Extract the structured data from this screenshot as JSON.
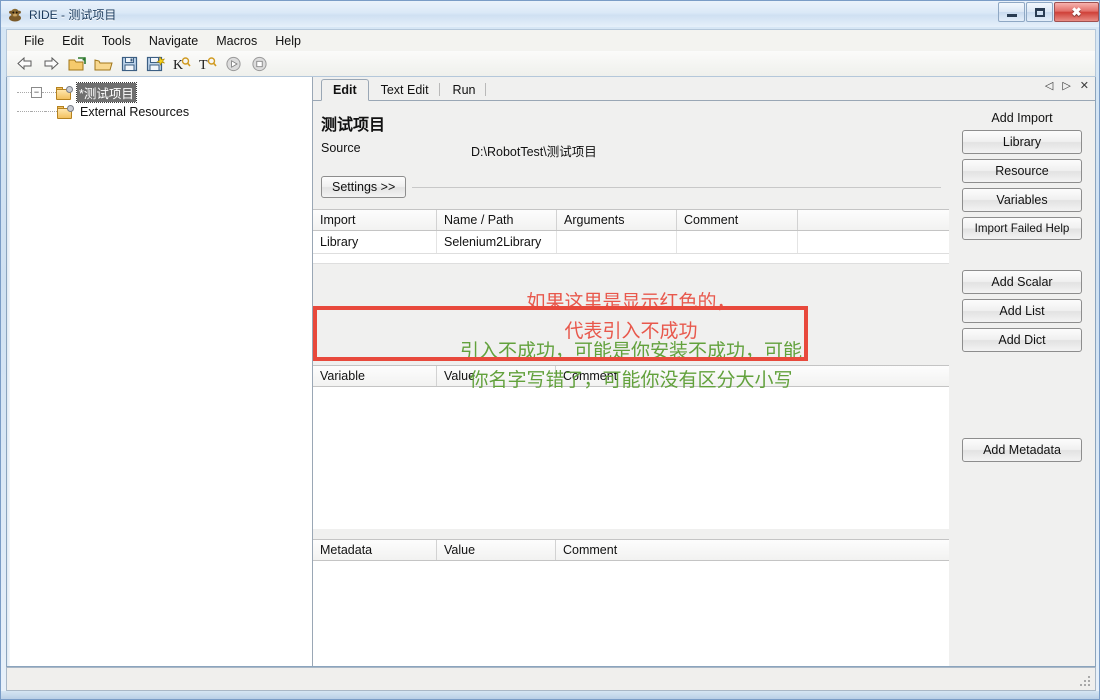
{
  "window": {
    "title": "RIDE - 测试项目",
    "app_icon": "robot-icon",
    "minimize_label": "Minimize",
    "maximize_label": "Maximize",
    "close_label": "✖"
  },
  "menubar": {
    "items": [
      {
        "label": "File",
        "name": "menu-file"
      },
      {
        "label": "Edit",
        "name": "menu-edit"
      },
      {
        "label": "Tools",
        "name": "menu-tools"
      },
      {
        "label": "Navigate",
        "name": "menu-navigate"
      },
      {
        "label": "Macros",
        "name": "menu-macros"
      },
      {
        "label": "Help",
        "name": "menu-help"
      }
    ]
  },
  "toolbar": {
    "buttons": [
      {
        "icon": "back-arrow-icon",
        "glyph": "⇦"
      },
      {
        "icon": "forward-arrow-icon",
        "glyph": "⇨"
      },
      {
        "icon": "open-directory-icon",
        "glyph": "📂"
      },
      {
        "icon": "open-file-icon",
        "glyph": "📁"
      },
      {
        "icon": "save-icon",
        "glyph": "💾"
      },
      {
        "icon": "save-all-icon",
        "glyph": "💾"
      },
      {
        "icon": "search-keyword-icon",
        "glyph": "K"
      },
      {
        "icon": "search-tests-icon",
        "glyph": "T"
      },
      {
        "icon": "run-icon",
        "glyph": "▶"
      },
      {
        "icon": "stop-icon",
        "glyph": "■"
      }
    ]
  },
  "tree": {
    "nodes": [
      {
        "label": "*测试项目",
        "name": "tree-node-project",
        "selected": true
      },
      {
        "label": "External Resources",
        "name": "tree-node-external-resources",
        "selected": false
      }
    ],
    "collapse_glyph": "−"
  },
  "tabs": {
    "items": [
      {
        "label": "Edit",
        "name": "tab-edit",
        "active": true
      },
      {
        "label": "Text Edit",
        "name": "tab-text-edit",
        "active": false
      },
      {
        "label": "Run",
        "name": "tab-run",
        "active": false
      }
    ],
    "nav_prev": "◁",
    "nav_next": "▷",
    "nav_close": "✕"
  },
  "project": {
    "title": "测试项目",
    "source_label": "Source",
    "source_value": "D:\\RobotTest\\测试项目",
    "settings_button": "Settings >>"
  },
  "import_grid": {
    "headers": [
      "Import",
      "Name / Path",
      "Arguments",
      "Comment"
    ],
    "rows": [
      [
        "Library",
        "Selenium2Library",
        "",
        ""
      ]
    ]
  },
  "variable_grid": {
    "headers": [
      "Variable",
      "Value",
      "Comment"
    ],
    "rows": []
  },
  "metadata_grid": {
    "headers": [
      "Metadata",
      "Value",
      "Comment"
    ],
    "rows": []
  },
  "annotations": {
    "red_text": "如果这里是显示红色的，\n代表引入不成功",
    "red_color": "#e8584c",
    "green_text": "引入不成功，可能是你安装不成功，可能\n你名字写错了，可能你没有区分大小写",
    "green_color": "#62a13c",
    "highlight_box_color": "#e8493c"
  },
  "sidebar": {
    "add_import_title": "Add Import",
    "import_buttons": [
      {
        "label": "Library",
        "name": "add-library-button"
      },
      {
        "label": "Resource",
        "name": "add-resource-button"
      },
      {
        "label": "Variables",
        "name": "add-variables-button"
      },
      {
        "label": "Import Failed Help",
        "name": "import-failed-help-button"
      }
    ],
    "variable_buttons": [
      {
        "label": "Add Scalar",
        "name": "add-scalar-button"
      },
      {
        "label": "Add List",
        "name": "add-list-button"
      },
      {
        "label": "Add Dict",
        "name": "add-dict-button"
      }
    ],
    "metadata_button": {
      "label": "Add Metadata",
      "name": "add-metadata-button"
    }
  },
  "statusbar": {
    "text": ""
  }
}
